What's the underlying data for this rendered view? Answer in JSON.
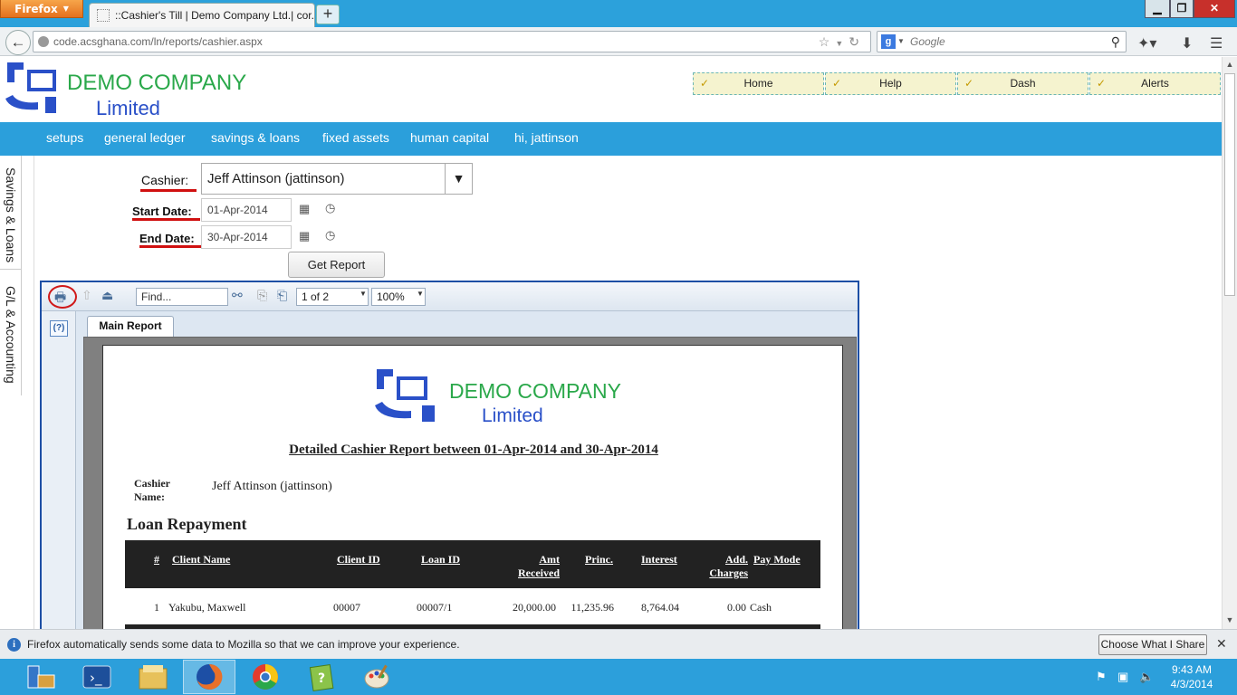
{
  "browser": {
    "menu_label": "Firefox",
    "tab_title": "::Cashier's Till | Demo Company Ltd.| cor...",
    "url": "code.acsghana.com/ln/reports/cashier.aspx",
    "search_placeholder": "Google",
    "search_engine_letter": "g"
  },
  "header": {
    "logo_company": "DEMO COMPANY",
    "logo_limited": "Limited",
    "quick_links": [
      "Home",
      "Help",
      "Dash",
      "Alerts"
    ]
  },
  "menu": [
    "setups",
    "general ledger",
    "savings & loans",
    "fixed assets",
    "human capital",
    "hi, jattinson"
  ],
  "side_tabs": [
    "Savings & Loans",
    "G/L & Accounting"
  ],
  "form": {
    "cashier_label": "Cashier:",
    "cashier_value": "Jeff Attinson (jattinson)",
    "start_label": "Start Date:",
    "start_value": "01-Apr-2014",
    "end_label": "End Date:",
    "end_value": "30-Apr-2014",
    "get_report_label": "Get Report"
  },
  "viewer": {
    "find_placeholder": "Find...",
    "page_indicator": "1 of 2",
    "zoom": "100%",
    "help_label": "(?)",
    "tab_label": "Main Report"
  },
  "report": {
    "logo_company": "DEMO COMPANY",
    "logo_limited": "Limited",
    "title": "Detailed Cashier Report between 01-Apr-2014 and 30-Apr-2014",
    "cashier_label": "Cashier Name:",
    "cashier_value": "Jeff Attinson (jattinson)",
    "section_title": "Loan Repayment",
    "columns": [
      "#",
      "Client Name",
      "Client ID",
      "Loan ID",
      "Amt Received",
      "Princ.",
      "Interest",
      "Add. Charges",
      "Pay Mode"
    ],
    "rows": [
      [
        "1",
        "Yakubu, Maxwell",
        "00007",
        "00007/1",
        "20,000.00",
        "11,235.96",
        "8,764.04",
        "0.00",
        "Cash"
      ]
    ]
  },
  "notification": {
    "message": "Firefox automatically sends some data to Mozilla so that we can improve your experience.",
    "button_label": "Choose What I Share"
  },
  "taskbar": {
    "time": "9:43 AM",
    "date": "4/3/2014"
  },
  "colors": {
    "titlebar": "#2ca1db",
    "menubar": "#2b9fdb",
    "logo_green": "#2aa84a",
    "logo_blue": "#2a50c8",
    "accent_red": "#d01010"
  }
}
